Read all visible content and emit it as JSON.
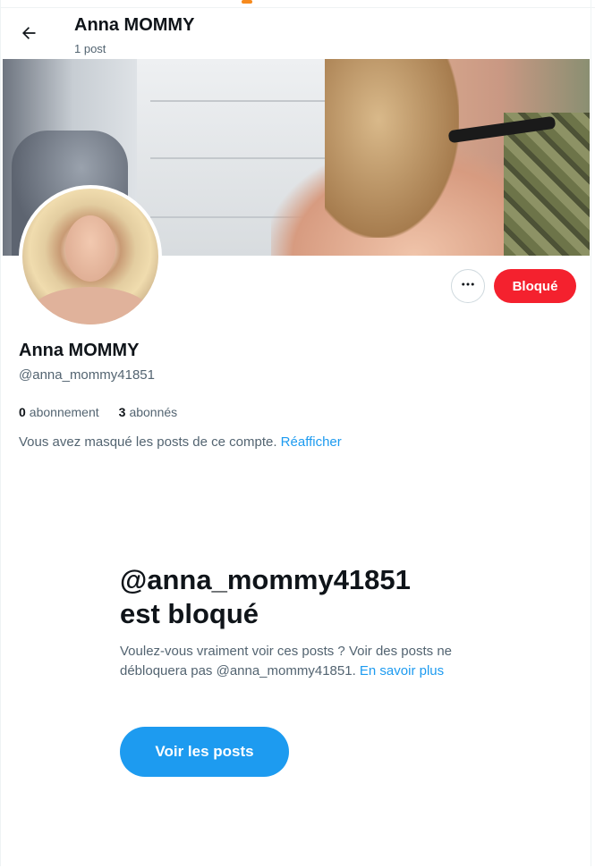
{
  "header": {
    "title": "Anna MOMMY",
    "post_count": "1 post",
    "back_icon": "arrow-left-icon"
  },
  "profile": {
    "name": "Anna MOMMY",
    "handle": "@anna_mommy41851",
    "following_count": "0",
    "following_label": "abonnement",
    "followers_count": "3",
    "followers_label": "abonnés",
    "more_icon": "more-horizontal-icon",
    "blocked_label": "Bloqué"
  },
  "hidden_notice": {
    "text": "Vous avez masqué les posts de ce compte. ",
    "link": "Réafficher"
  },
  "blocked_panel": {
    "title_line1": "@anna_mommy41851",
    "title_line2": "est bloqué",
    "description": "Voulez-vous vraiment voir ces posts ? Voir des posts ne débloquera pas @anna_mommy41851. ",
    "learn_more": "En savoir plus",
    "view_posts_label": "Voir les posts"
  },
  "colors": {
    "accent": "#1d9bf0",
    "danger": "#f4212e",
    "text_primary": "#0f1419",
    "text_secondary": "#536471"
  }
}
